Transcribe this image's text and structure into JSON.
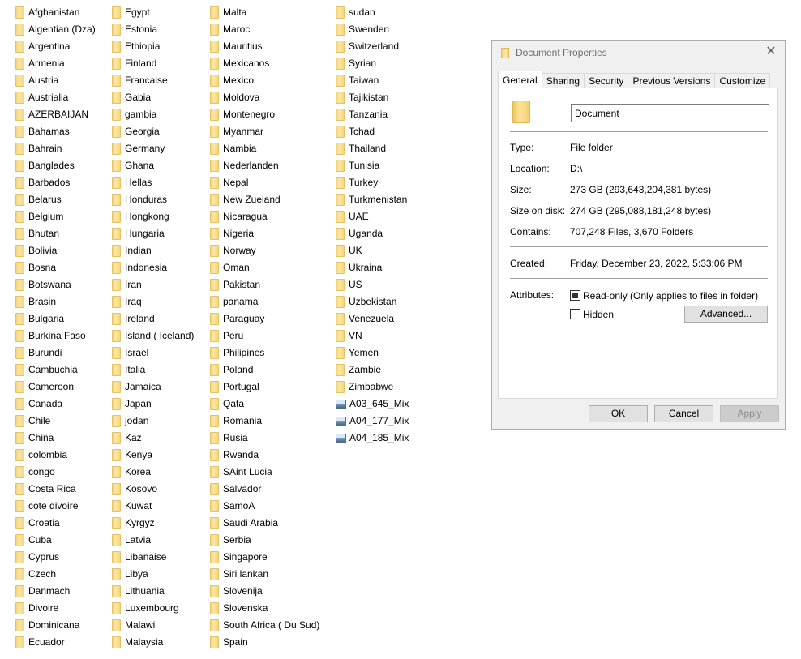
{
  "file_list": {
    "col1": [
      "Afghanistan",
      "Algentian (Dza)",
      "Argentina",
      "Armenia",
      "Austria",
      "Austrialia",
      "AZERBAIJAN",
      "Bahamas",
      "Bahrain",
      "Banglades",
      "Barbados",
      "Belarus",
      "Belgium",
      "Bhutan",
      "Bolivia",
      "Bosna",
      "Botswana",
      "Brasin",
      "Bulgaria",
      "Burkina Faso",
      "Burundi",
      "Cambuchia",
      "Cameroon",
      "Canada",
      "Chile",
      "China",
      "colombia",
      "congo",
      "Costa Rica",
      "cote divoire",
      "Croatia",
      "Cuba",
      "Cyprus",
      "Czech",
      "Danmach",
      "Divoire",
      "Dominicana",
      "Ecuador"
    ],
    "col2": [
      "Egypt",
      "Estonia",
      "Ethiopia",
      "Finland",
      "Francaise",
      "Gabia",
      "gambia",
      "Georgia",
      "Germany",
      "Ghana",
      "Hellas",
      "Honduras",
      "Hongkong",
      "Hungaria",
      "Indian",
      "Indonesia",
      "Iran",
      "Iraq",
      "Ireland",
      "Island ( Iceland)",
      "Israel",
      "Italia",
      "Jamaica",
      "Japan",
      "jodan",
      "Kaz",
      "Kenya",
      "Korea",
      "Kosovo",
      "Kuwat",
      "Kyrgyz",
      "Latvia",
      "Libanaise",
      "Libya",
      "Lithuania",
      "Luxembourg",
      "Malawi",
      "Malaysia"
    ],
    "col3": [
      "Malta",
      "Maroc",
      "Mauritius",
      "Mexicanos",
      "Mexico",
      "Moldova",
      "Montenegro",
      "Myanmar",
      "Nambia",
      "Nederlanden",
      "Nepal",
      "New Zueland",
      "Nicaragua",
      "Nigeria",
      "Norway",
      "Oman",
      "Pakistan",
      "panama",
      "Paraguay",
      "Peru",
      "Philipines",
      "Poland",
      "Portugal",
      "Qata",
      "Romania",
      "Rusia",
      "Rwanda",
      "SAint Lucia",
      "Salvador",
      "SamoA",
      "Saudi Arabia",
      "Serbia",
      "Singapore",
      "Siri lankan",
      "Slovenija",
      "Slovenska",
      "South Africa ( Du Sud)",
      "Spain"
    ],
    "col4": [
      "sudan",
      "Swenden",
      "Switzerland",
      "Syrian",
      "Taiwan",
      "Tajikistan",
      "Tanzania",
      "Tchad",
      "Thailand",
      "Tunisia",
      "Turkey",
      "Turkmenistan",
      "UAE",
      "Uganda",
      "UK",
      "Ukraina",
      "US",
      "Uzbekistan",
      "Venezuela",
      "VN",
      "Yemen",
      "Zambie",
      "Zimbabwe"
    ],
    "col4_images": [
      "A03_645_Mix",
      "A04_177_Mix",
      "A04_185_Mix"
    ]
  },
  "dialog": {
    "title": "Document Properties",
    "close_glyph": "✕",
    "tabs": [
      "General",
      "Sharing",
      "Security",
      "Previous Versions",
      "Customize"
    ],
    "name_value": "Document",
    "props": {
      "type_label": "Type:",
      "type_value": "File folder",
      "location_label": "Location:",
      "location_value": "D:\\",
      "size_label": "Size:",
      "size_value": "273 GB (293,643,204,381 bytes)",
      "size_on_disk_label": "Size on disk:",
      "size_on_disk_value": "274 GB (295,088,181,248 bytes)",
      "contains_label": "Contains:",
      "contains_value": "707,248 Files, 3,670 Folders",
      "created_label": "Created:",
      "created_value": "Friday, December 23, 2022, 5:33:06 PM",
      "attributes_label": "Attributes:",
      "readonly_label": "Read-only (Only applies to files in folder)",
      "hidden_label": "Hidden",
      "advanced_label": "Advanced..."
    },
    "buttons": {
      "ok": "OK",
      "cancel": "Cancel",
      "apply": "Apply"
    }
  }
}
